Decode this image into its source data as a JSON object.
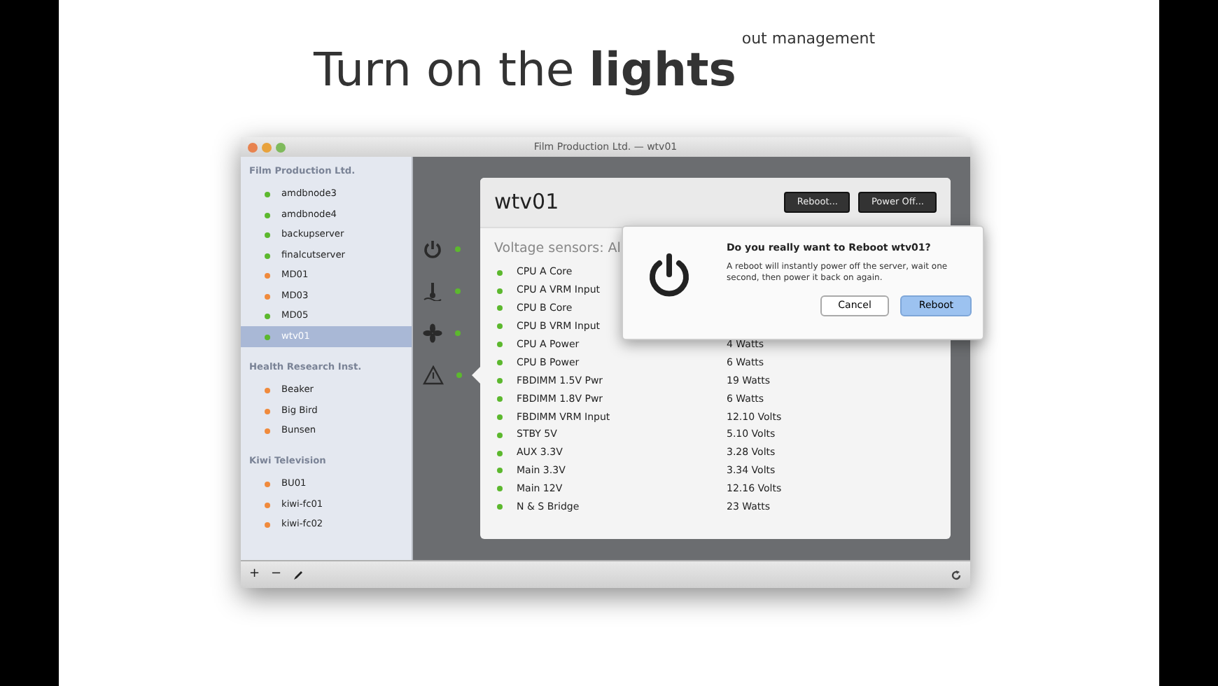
{
  "headline": {
    "text": "Turn on the **lights**",
    "superscript": "out management"
  },
  "window": {
    "title": "Film Production Ltd. — wtv01"
  },
  "sidebar": {
    "groups": [
      {
        "title": "Film Production Ltd.",
        "items": [
          {
            "name": "amdbnode3",
            "color": "#5cb82e",
            "selected": false
          },
          {
            "name": "amdbnode4",
            "color": "#5cb82e",
            "selected": false
          },
          {
            "name": "backupserver",
            "color": "#5cb82e",
            "selected": false
          },
          {
            "name": "finalcutserver",
            "color": "#5cb82e",
            "selected": false
          },
          {
            "name": "MD01",
            "color": "#f08a3c",
            "selected": false
          },
          {
            "name": "MD03",
            "color": "#f08a3c",
            "selected": false
          },
          {
            "name": "MD05",
            "color": "#5cb82e",
            "selected": false
          },
          {
            "name": "wtv01",
            "color": "#5cb82e",
            "selected": true
          }
        ]
      },
      {
        "title": "Health Research Inst.",
        "items": [
          {
            "name": "Beaker",
            "color": "#f08a3c",
            "selected": false
          },
          {
            "name": "Big Bird",
            "color": "#f08a3c",
            "selected": false
          },
          {
            "name": "Bunsen",
            "color": "#f08a3c",
            "selected": false
          }
        ]
      },
      {
        "title": "Kiwi Television",
        "items": [
          {
            "name": "BU01",
            "color": "#f08a3c",
            "selected": false
          },
          {
            "name": "kiwi-fc01",
            "color": "#f08a3c",
            "selected": false
          },
          {
            "name": "kiwi-fc02",
            "color": "#f08a3c",
            "selected": false
          }
        ]
      }
    ],
    "toolbar": [
      "+",
      "−"
    ]
  },
  "categories": [
    {
      "kind": "power",
      "color": "#5cb82e",
      "selected": false
    },
    {
      "kind": "temperature",
      "color": "#5cb82e",
      "selected": false
    },
    {
      "kind": "fan",
      "color": "#5cb82e",
      "selected": false
    },
    {
      "kind": "warning",
      "color": "#5cb82e",
      "selected": true
    }
  ],
  "panel": {
    "title": "wtv01",
    "buttons": [
      "Reboot...",
      "Power Off..."
    ],
    "section": "Voltage sensors: Al",
    "sensors": [
      {
        "name": "CPU A Core",
        "color": "#5cb82e"
      },
      {
        "name": "CPU A VRM Input",
        "color": "#5cb82e"
      },
      {
        "name": "CPU B Core",
        "color": "#5cb82e"
      },
      {
        "name": "CPU B VRM Input",
        "color": "#5cb82e"
      },
      {
        "name": "CPU A Power",
        "value": "4 Watts",
        "color": "#5cb82e"
      },
      {
        "name": "CPU B Power",
        "value": "6 Watts",
        "color": "#5cb82e"
      },
      {
        "name": "FBDIMM 1.5V Pwr",
        "value": "19 Watts",
        "color": "#5cb82e"
      },
      {
        "name": "FBDIMM 1.8V Pwr",
        "value": "6 Watts",
        "color": "#5cb82e"
      },
      {
        "name": "FBDIMM VRM Input",
        "value": "12.10 Volts",
        "color": "#5cb82e"
      },
      {
        "name": "STBY 5V",
        "value": "5.10 Volts",
        "color": "#5cb82e"
      },
      {
        "name": "AUX 3.3V",
        "value": "3.28 Volts",
        "color": "#5cb82e"
      },
      {
        "name": "Main 3.3V",
        "value": "3.34 Volts",
        "color": "#5cb82e"
      },
      {
        "name": "Main 12V",
        "value": "12.16 Volts",
        "color": "#5cb82e"
      },
      {
        "name": "N & S Bridge",
        "value": "23 Watts",
        "color": "#5cb82e"
      }
    ]
  },
  "dialog": {
    "title": "Do you really want to Reboot wtv01?",
    "message": "A reboot will instantly power off the server, wait one second, then power it back on again.",
    "buttons": [
      {
        "label": "Cancel",
        "default": false
      },
      {
        "label": "Reboot",
        "default": true
      }
    ]
  }
}
